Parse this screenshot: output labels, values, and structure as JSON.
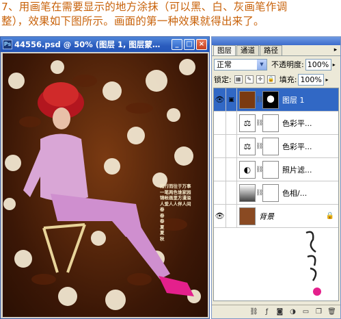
{
  "caption": {
    "line1": "7、用画笔在需要显示的地方涂抹（可以黑、白、灰画笔作调",
    "line2": "整），效果如下图所示。画面的第一种效果就得出来了。"
  },
  "document": {
    "title": "44556.psd @ 50% (图层 1, 图层蒙…",
    "icon": "photoshop-icon",
    "buttons": {
      "minimize": "_",
      "maximize": "□",
      "close": "×"
    },
    "poem_lines": [
      "踏行而往于万事",
      "一笔两色谁家园",
      "锦帐画里方漫溢",
      "人爱人人伴人间",
      "春",
      "春",
      "春",
      "夏",
      "夏",
      "秋"
    ]
  },
  "layers_panel": {
    "tabs": [
      {
        "label": "图层",
        "active": true
      },
      {
        "label": "通道",
        "active": false
      },
      {
        "label": "路径",
        "active": false
      }
    ],
    "blend_mode": "正常",
    "opacity_label": "不透明度:",
    "opacity_value": "100%",
    "lock_label": "锁定:",
    "fill_label": "填充:",
    "fill_value": "100%",
    "layers": [
      {
        "name": "图层 1",
        "visible": true,
        "selected": true,
        "thumb": "photo-thumb",
        "mask": "dark"
      },
      {
        "name": "色彩平...",
        "visible": false,
        "selected": false,
        "thumb": "balance-icon",
        "mask": "white"
      },
      {
        "name": "色彩平...",
        "visible": false,
        "selected": false,
        "thumb": "balance-icon",
        "mask": "white"
      },
      {
        "name": "照片滤...",
        "visible": false,
        "selected": false,
        "thumb": "filter-icon",
        "mask": "white"
      },
      {
        "name": "色相/...",
        "visible": false,
        "selected": false,
        "thumb": "hue-icon",
        "mask": "white"
      },
      {
        "name": "背景",
        "visible": true,
        "selected": false,
        "thumb": "photo-thumb",
        "mask": "none",
        "locked": true
      }
    ]
  },
  "colors": {
    "caption": "#c8620a",
    "titlebar": "#2a5bbd",
    "selected_layer": "#3168c5"
  }
}
